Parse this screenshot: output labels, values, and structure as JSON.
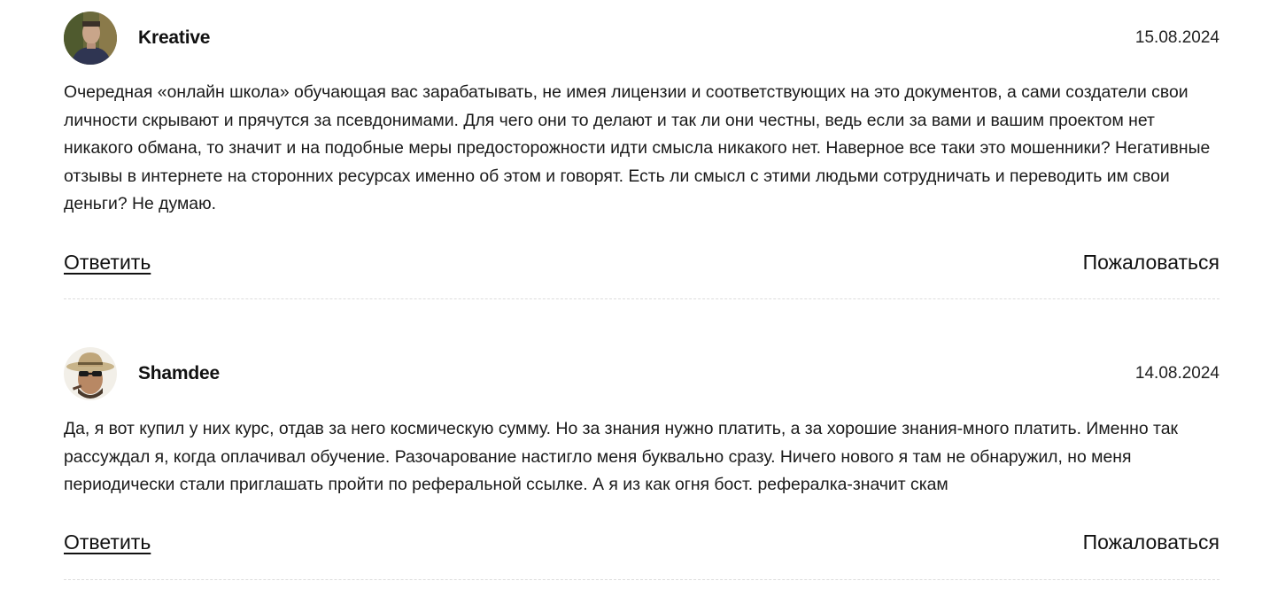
{
  "comments": [
    {
      "author": "Kreative",
      "date": "15.08.2024",
      "avatar": "user-photo-icon",
      "text": "Очередная «онлайн школа» обучающая вас зарабатывать, не имея лицензии и соответствующих на это документов, а сами создатели свои личности скрывают и прячутся за псевдонимами. Для чего они то делают и так ли они честны, ведь если за вами и вашим проектом нет никакого обмана, то значит и на подобные меры предосторожности идти смысла никакого нет. Наверное все таки это мошенники? Негативные отзывы в интернете на сторонних ресурсах именно об этом и говорят. Есть ли смысл с этими людьми сотрудничать и переводить им свои деньги? Не думаю.",
      "reply_label": "Ответить",
      "report_label": "Пожаловаться"
    },
    {
      "author": "Shamdee",
      "date": "14.08.2024",
      "avatar": "user-photo-icon",
      "text": "Да, я вот купил у них курс, отдав за него космическую сумму. Но за знания нужно платить, а за хорошие знания-много платить. Именно так рассуждал я, когда оплачивал обучение. Разочарование настигло меня буквально сразу. Ничего нового я там не обнаружил, но меня периодически стали приглашать пройти по реферальной ссылке. А я из как огня бост. рефералка-значит скам",
      "reply_label": "Ответить",
      "report_label": "Пожаловаться"
    }
  ]
}
